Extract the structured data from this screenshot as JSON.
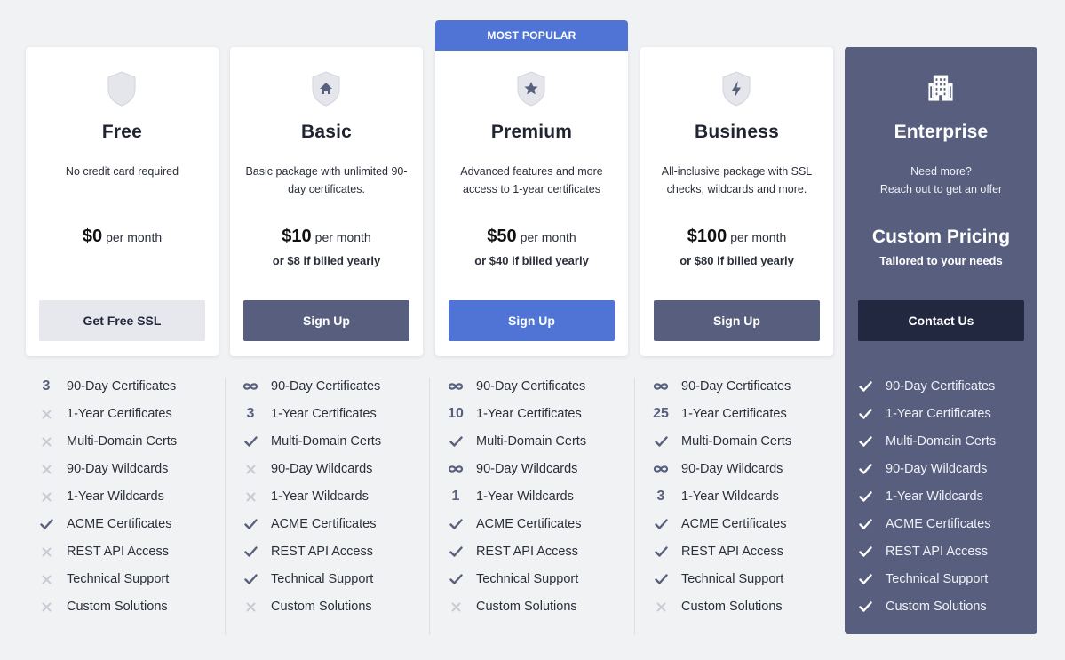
{
  "badge": "MOST POPULAR",
  "plans": [
    {
      "name": "Free",
      "description": "No credit card required",
      "price": "$0",
      "per": "per month",
      "yearly": "",
      "button": "Get Free SSL",
      "icon": "shield-icon",
      "features": [
        "3",
        "x",
        "x",
        "x",
        "x",
        "check",
        "x",
        "x",
        "x"
      ]
    },
    {
      "name": "Basic",
      "description": "Basic package with unlimited 90-day certificates.",
      "price": "$10",
      "per": "per month",
      "yearly": "or $8 if billed yearly",
      "button": "Sign Up",
      "icon": "shield-home-icon",
      "features": [
        "∞",
        "3",
        "check",
        "x",
        "x",
        "check",
        "check",
        "check",
        "x"
      ]
    },
    {
      "name": "Premium",
      "description": "Advanced features and more access to 1-year certificates",
      "price": "$50",
      "per": "per month",
      "yearly": "or $40 if billed yearly",
      "button": "Sign Up",
      "icon": "shield-star-icon",
      "features": [
        "∞",
        "10",
        "check",
        "∞",
        "1",
        "check",
        "check",
        "check",
        "x"
      ]
    },
    {
      "name": "Business",
      "description": "All-inclusive package with SSL checks, wildcards and more.",
      "price": "$100",
      "per": "per month",
      "yearly": "or $80 if billed yearly",
      "button": "Sign Up",
      "icon": "shield-bolt-icon",
      "features": [
        "∞",
        "25",
        "check",
        "∞",
        "3",
        "check",
        "check",
        "check",
        "x"
      ]
    },
    {
      "name": "Enterprise",
      "description_line1": "Need more?",
      "description_line2": "Reach out to get an offer",
      "price": "Custom Pricing",
      "yearly": "Tailored to your needs",
      "button": "Contact Us",
      "icon": "building-icon",
      "features": [
        "check",
        "check",
        "check",
        "check",
        "check",
        "check",
        "check",
        "check",
        "check"
      ]
    }
  ],
  "feature_labels": [
    "90-Day Certificates",
    "1-Year Certificates",
    "Multi-Domain Certs",
    "90-Day Wildcards",
    "1-Year Wildcards",
    "ACME Certificates",
    "REST API Access",
    "Technical Support",
    "Custom Solutions"
  ],
  "colors": {
    "accent": "#4f74d6",
    "slate": "#585f7e",
    "dark": "#22283f",
    "background": "#f1f2f4"
  }
}
